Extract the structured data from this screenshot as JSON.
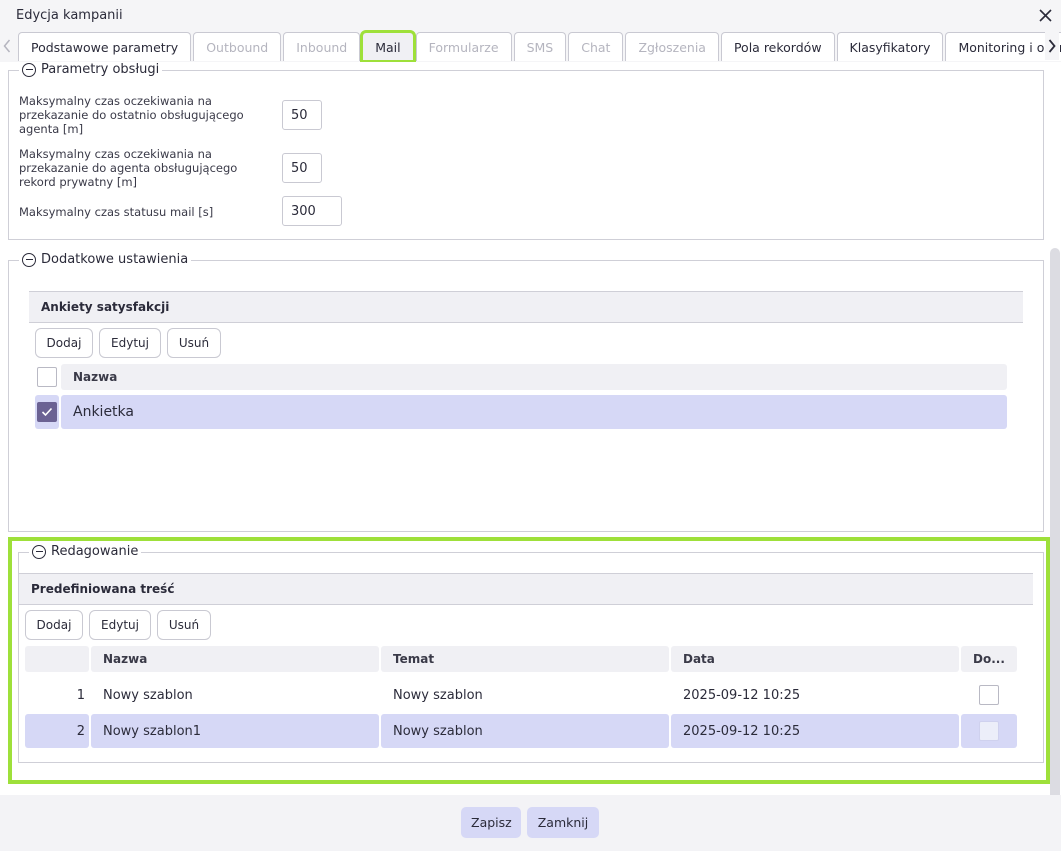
{
  "window": {
    "title": "Edycja kampanii"
  },
  "colors": {
    "accent": "#d6d8f6",
    "highlight": "#9ee03a",
    "checkbox_checked": "#6b6293"
  },
  "tabs": [
    {
      "label": "Podstawowe parametry",
      "state": "enabled"
    },
    {
      "label": "Outbound",
      "state": "disabled"
    },
    {
      "label": "Inbound",
      "state": "disabled"
    },
    {
      "label": "Mail",
      "state": "active"
    },
    {
      "label": "Formularze",
      "state": "disabled"
    },
    {
      "label": "SMS",
      "state": "disabled"
    },
    {
      "label": "Chat",
      "state": "disabled"
    },
    {
      "label": "Zgłoszenia",
      "state": "disabled"
    },
    {
      "label": "Pola rekordów",
      "state": "enabled"
    },
    {
      "label": "Klasyfikatory",
      "state": "enabled"
    },
    {
      "label": "Monitoring i ocena",
      "state": "enabled"
    }
  ],
  "params": {
    "legend": "Parametry obsługi",
    "fields": [
      {
        "label": "Maksymalny czas oczekiwania na przekazanie do ostatnio obsługującego agenta [m]",
        "value": "50"
      },
      {
        "label": "Maksymalny czas oczekiwania na przekazanie do agenta obsługującego rekord prywatny [m]",
        "value": "50"
      },
      {
        "label": "Maksymalny czas statusu mail [s]",
        "value": "300"
      }
    ]
  },
  "additional": {
    "legend": "Dodatkowe ustawienia",
    "surveys": {
      "header": "Ankiety satysfakcji",
      "buttons": {
        "add": "Dodaj",
        "edit": "Edytuj",
        "delete": "Usuń"
      },
      "columns": {
        "name": "Nazwa"
      },
      "rows": [
        {
          "name": "Ankietka",
          "checked": true
        }
      ]
    }
  },
  "editing": {
    "legend": "Redagowanie",
    "predefined": {
      "header": "Predefiniowana treść",
      "buttons": {
        "add": "Dodaj",
        "edit": "Edytuj",
        "delete": "Usuń"
      },
      "columns": {
        "name": "Nazwa",
        "subject": "Temat",
        "date": "Data",
        "default": "Do..."
      },
      "rows": [
        {
          "num": "1",
          "name": "Nowy szablon",
          "subject": "Nowy szablon",
          "date": "2025-09-12 10:25",
          "checked": false
        },
        {
          "num": "2",
          "name": "Nowy szablon1",
          "subject": "Nowy szablon",
          "date": "2025-09-12 10:25",
          "checked": false
        }
      ]
    }
  },
  "footer": {
    "save": "Zapisz",
    "close": "Zamknij"
  }
}
